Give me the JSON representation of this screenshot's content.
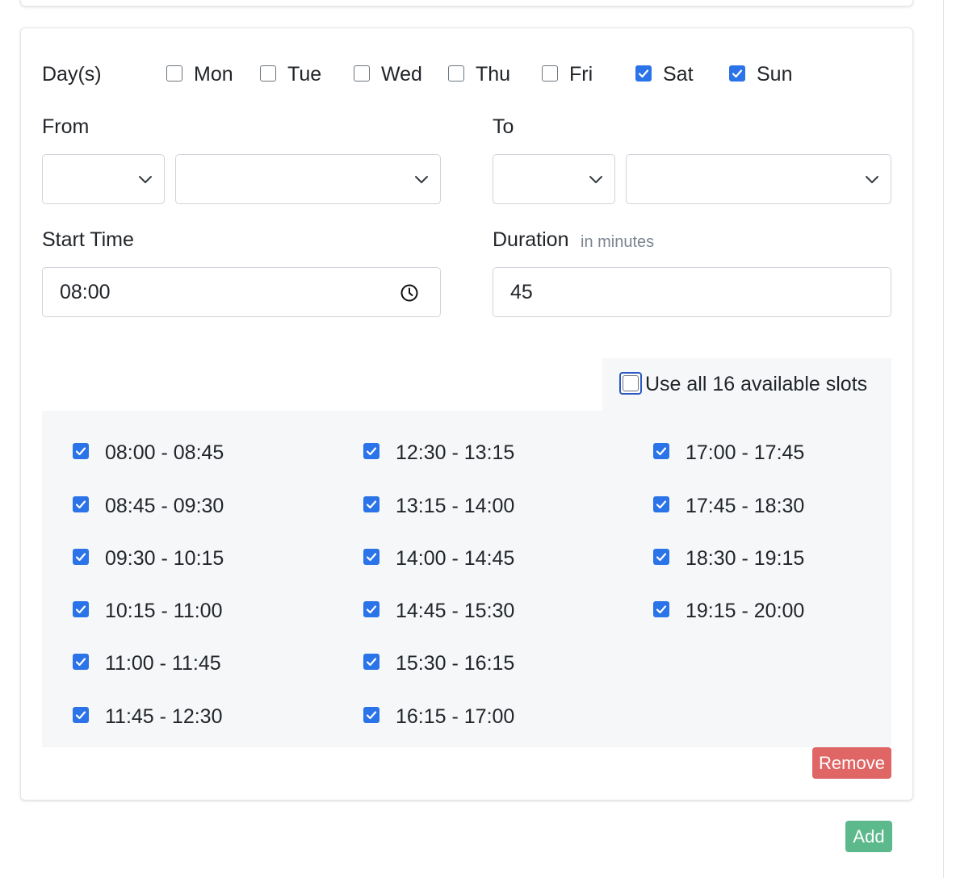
{
  "days": {
    "label": "Day(s)",
    "items": [
      {
        "label": "Mon",
        "checked": false
      },
      {
        "label": "Tue",
        "checked": false
      },
      {
        "label": "Wed",
        "checked": false
      },
      {
        "label": "Thu",
        "checked": false
      },
      {
        "label": "Fri",
        "checked": false
      },
      {
        "label": "Sat",
        "checked": true
      },
      {
        "label": "Sun",
        "checked": true
      }
    ]
  },
  "from": {
    "label": "From",
    "select_1": "",
    "select_2": ""
  },
  "to": {
    "label": "To",
    "select_1": "",
    "select_2": ""
  },
  "start_time": {
    "label": "Start Time",
    "value": "08:00"
  },
  "duration": {
    "label": "Duration",
    "hint": "in minutes",
    "value": "45"
  },
  "use_all": {
    "label": "Use all 16 available slots",
    "checked": false
  },
  "slots": [
    {
      "label": "08:00 - 08:45",
      "checked": true
    },
    {
      "label": "08:45 - 09:30",
      "checked": true
    },
    {
      "label": "09:30 - 10:15",
      "checked": true
    },
    {
      "label": "10:15 - 11:00",
      "checked": true
    },
    {
      "label": "11:00 - 11:45",
      "checked": true
    },
    {
      "label": "11:45 - 12:30",
      "checked": true
    },
    {
      "label": "12:30 - 13:15",
      "checked": true
    },
    {
      "label": "13:15 - 14:00",
      "checked": true
    },
    {
      "label": "14:00 - 14:45",
      "checked": true
    },
    {
      "label": "14:45 - 15:30",
      "checked": true
    },
    {
      "label": "15:30 - 16:15",
      "checked": true
    },
    {
      "label": "16:15 - 17:00",
      "checked": true
    },
    {
      "label": "17:00 - 17:45",
      "checked": true
    },
    {
      "label": "17:45 - 18:30",
      "checked": true
    },
    {
      "label": "18:30 - 19:15",
      "checked": true
    },
    {
      "label": "19:15 - 20:00",
      "checked": true
    }
  ],
  "buttons": {
    "remove": "Remove",
    "add": "Add"
  },
  "colors": {
    "accent": "#2b73e8",
    "remove": "#e06565",
    "add": "#5cb98c",
    "panel": "#f6f7f9"
  }
}
